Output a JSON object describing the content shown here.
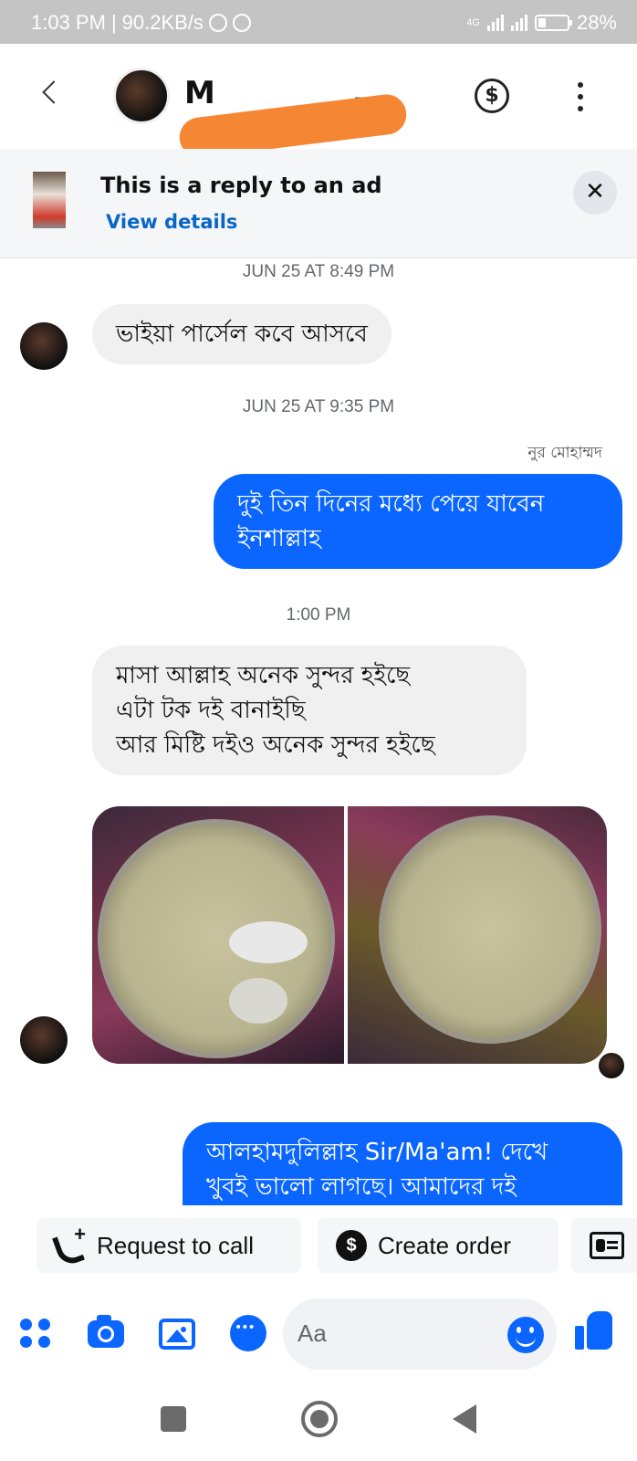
{
  "status_bar": {
    "time": "1:03 PM",
    "speed": "90.2KB/s",
    "network": "4G",
    "battery": "28%"
  },
  "header": {
    "contact_name_visible": "M",
    "contact_name_tail": "...",
    "back_icon": "chevron-left-icon",
    "payment_icon": "dollar-circle-icon",
    "more_icon": "vertical-dots-icon"
  },
  "ad_banner": {
    "title": "This is a reply to an ad",
    "link": "View details"
  },
  "messages": {
    "ts1": "JUN 25 AT 8:49 PM",
    "m1": "ভাইয়া পার্সেল কবে আসবে",
    "ts2": "JUN 25 AT 9:35 PM",
    "sender_name": "নুর মোহাম্মদ",
    "m2_line1": "দুই তিন দিনের মধ্যে পেয়ে যাবেন",
    "m2_line2": "ইনশাল্লাহ",
    "ts3": "1:00 PM",
    "m3_line1": "মাসা আল্লাহ  অনেক সুন্দর হইছে",
    "m3_line2": "এটা টক দই বানাইছি",
    "m3_line3": "আর মিষ্টি দইও অনেক সুন্দর হইছে",
    "m4_line1": "আলহামদুলিল্লাহ Sir/Ma'am! দেখে",
    "m4_line2": "খুবই ভালো লাগছে। আমাদের দই"
  },
  "quick_actions": {
    "request_call": "Request to call",
    "create_order": "Create order",
    "dollar_glyph": "$"
  },
  "composer": {
    "placeholder": "Aa"
  },
  "colors": {
    "accent": "#0a66ff",
    "link": "#0866c6",
    "incoming_bubble": "#f0f0f0",
    "redaction": "#f58634"
  }
}
